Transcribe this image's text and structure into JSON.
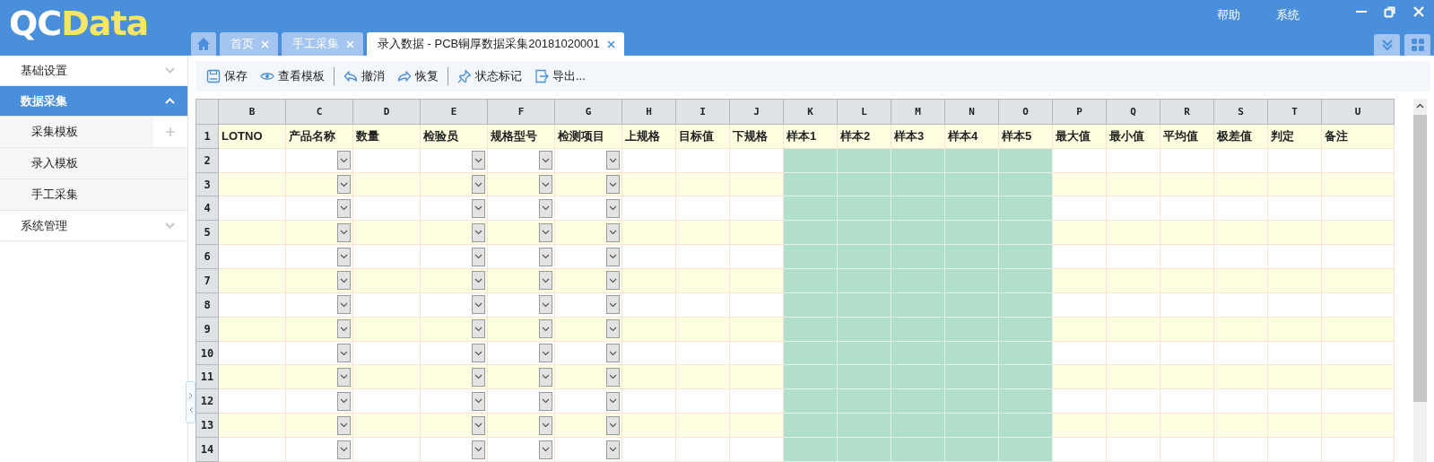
{
  "header": {
    "logo": [
      "QC",
      "Data"
    ],
    "menu": [
      "帮助",
      "系统"
    ]
  },
  "tabs": [
    {
      "label": "首页",
      "selected": false
    },
    {
      "label": "手工采集",
      "selected": false
    },
    {
      "label": "录入数据 - PCB铜厚数据采集20181020001",
      "selected": true
    }
  ],
  "sidebar": {
    "items": [
      {
        "label": "基础设置",
        "selected": false,
        "expanded": false
      },
      {
        "label": "数据采集",
        "selected": true,
        "expanded": true,
        "children": [
          {
            "label": "采集模板",
            "add_button": true
          },
          {
            "label": "录入模板",
            "add_button": false
          },
          {
            "label": "手工采集",
            "add_button": false
          }
        ]
      },
      {
        "label": "系统管理",
        "selected": false,
        "expanded": false
      }
    ]
  },
  "toolbar": [
    [
      {
        "label": "保存",
        "kind": "save"
      },
      {
        "label": "查看模板",
        "kind": "view"
      }
    ],
    [
      {
        "label": "撤消",
        "kind": "undo"
      },
      {
        "label": "恢复",
        "kind": "redo"
      }
    ],
    [
      {
        "label": "状态标记",
        "kind": "mark"
      },
      {
        "label": "导出...",
        "kind": "export"
      }
    ]
  ],
  "sheet": {
    "columns": [
      {
        "letter": "B",
        "header": "LOTNO",
        "kind": "text"
      },
      {
        "letter": "C",
        "header": "产品名称",
        "kind": "select"
      },
      {
        "letter": "D",
        "header": "数量",
        "kind": "text"
      },
      {
        "letter": "E",
        "header": "检验员",
        "kind": "select"
      },
      {
        "letter": "F",
        "header": "规格型号",
        "kind": "select"
      },
      {
        "letter": "G",
        "header": "检测项目",
        "kind": "select"
      },
      {
        "letter": "H",
        "header": "上规格",
        "kind": "text"
      },
      {
        "letter": "I",
        "header": "目标值",
        "kind": "text"
      },
      {
        "letter": "J",
        "header": "下规格",
        "kind": "text"
      },
      {
        "letter": "K",
        "header": "样本1",
        "kind": "sample"
      },
      {
        "letter": "L",
        "header": "样本2",
        "kind": "sample"
      },
      {
        "letter": "M",
        "header": "样本3",
        "kind": "sample"
      },
      {
        "letter": "N",
        "header": "样本4",
        "kind": "sample"
      },
      {
        "letter": "O",
        "header": "样本5",
        "kind": "sample"
      },
      {
        "letter": "P",
        "header": "最大值",
        "kind": "text"
      },
      {
        "letter": "Q",
        "header": "最小值",
        "kind": "text"
      },
      {
        "letter": "R",
        "header": "平均值",
        "kind": "text"
      },
      {
        "letter": "S",
        "header": "极差值",
        "kind": "text"
      },
      {
        "letter": "T",
        "header": "判定",
        "kind": "text"
      },
      {
        "letter": "U",
        "header": "备注",
        "kind": "text"
      }
    ],
    "row_numbers": [
      "1",
      "2",
      "3",
      "4",
      "5",
      "6",
      "7",
      "8",
      "9",
      "10",
      "11",
      "12",
      "13",
      "14"
    ]
  }
}
